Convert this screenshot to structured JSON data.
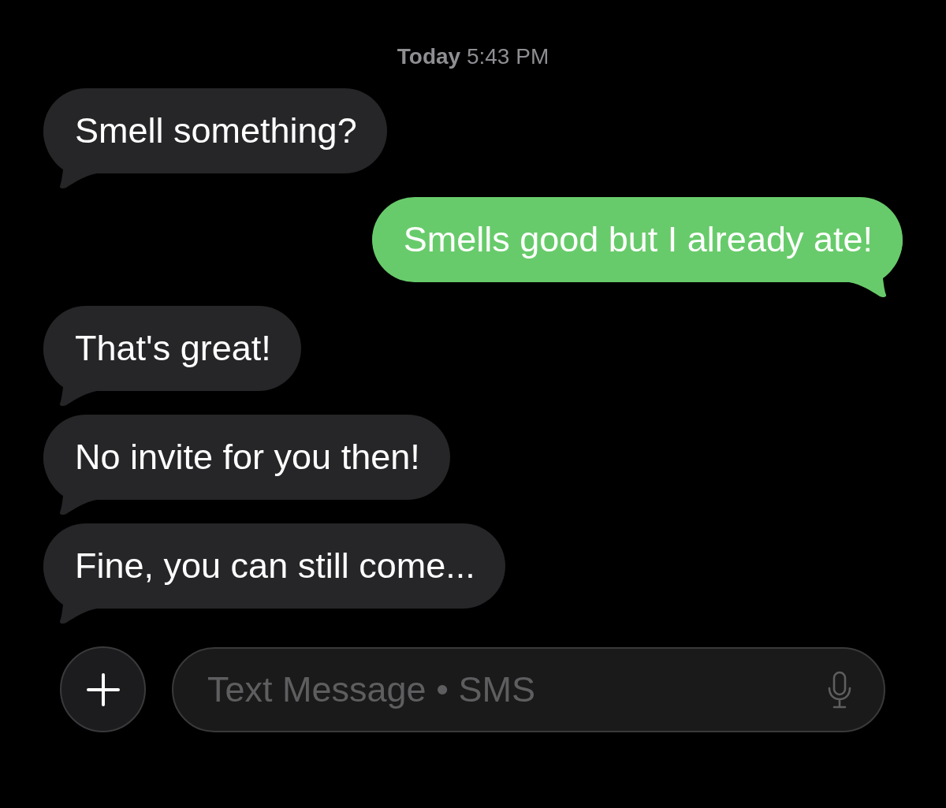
{
  "timestamp": "**Today** 5:43 PM",
  "messages": [
    {
      "kind": "incoming",
      "text": "Smell something?"
    },
    {
      "kind": "outgoing",
      "text": "Smells good but I already ate!"
    },
    {
      "kind": "incoming",
      "text": "That's great!"
    },
    {
      "kind": "incoming",
      "text": "No invite for you then!"
    },
    {
      "kind": "incoming",
      "text": "Fine, you can still come..."
    }
  ],
  "composer": {
    "placeholder": "Text Message • SMS"
  }
}
